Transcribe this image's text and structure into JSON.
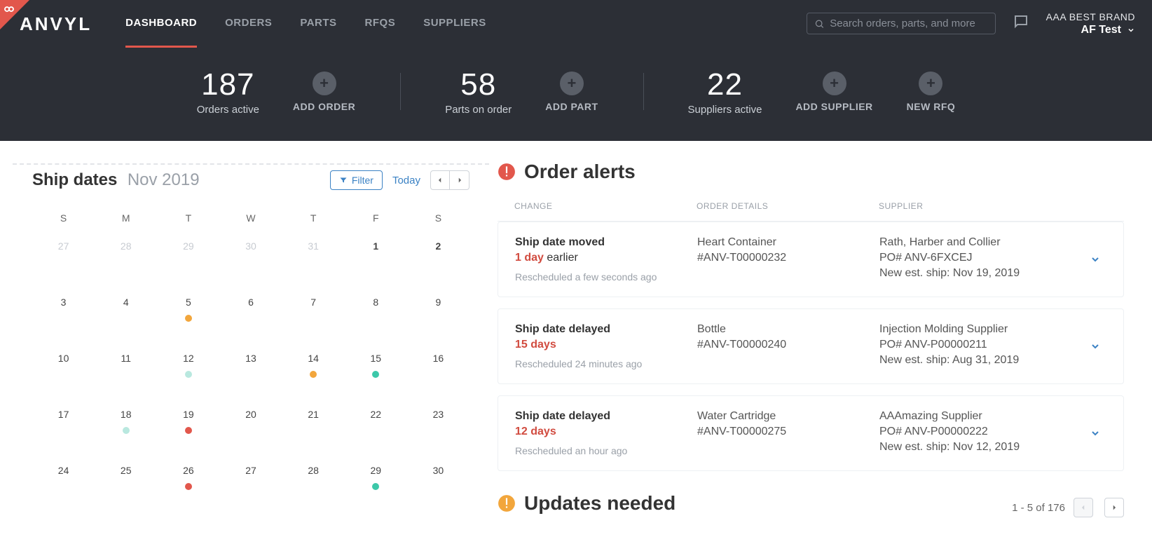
{
  "header": {
    "logo": "ANVYL",
    "nav": [
      "DASHBOARD",
      "ORDERS",
      "PARTS",
      "RFQS",
      "SUPPLIERS"
    ],
    "nav_active_index": 0,
    "search_placeholder": "Search orders, parts, and more",
    "brand_name": "AAA BEST BRAND",
    "brand_user": "AF Test"
  },
  "stats": [
    {
      "value": "187",
      "label": "Orders active",
      "actions": [
        {
          "label": "ADD ORDER"
        }
      ]
    },
    {
      "value": "58",
      "label": "Parts on order",
      "actions": [
        {
          "label": "ADD PART"
        }
      ]
    },
    {
      "value": "22",
      "label": "Suppliers active",
      "actions": [
        {
          "label": "ADD SUPPLIER"
        },
        {
          "label": "NEW RFQ"
        }
      ]
    }
  ],
  "calendar": {
    "title": "Ship dates",
    "month": "Nov 2019",
    "filter_label": "Filter",
    "today_label": "Today",
    "dow": [
      "S",
      "M",
      "T",
      "W",
      "T",
      "F",
      "S"
    ],
    "cells": [
      {
        "n": "27",
        "dim": true
      },
      {
        "n": "28",
        "dim": true
      },
      {
        "n": "29",
        "dim": true
      },
      {
        "n": "30",
        "dim": true
      },
      {
        "n": "31",
        "dim": true
      },
      {
        "n": "1",
        "bold": true
      },
      {
        "n": "2",
        "bold": true
      },
      {
        "n": "3"
      },
      {
        "n": "4"
      },
      {
        "n": "5",
        "dot": "orange"
      },
      {
        "n": "6"
      },
      {
        "n": "7"
      },
      {
        "n": "8"
      },
      {
        "n": "9"
      },
      {
        "n": "10"
      },
      {
        "n": "11"
      },
      {
        "n": "12",
        "dot": "mint"
      },
      {
        "n": "13"
      },
      {
        "n": "14",
        "dot": "orange"
      },
      {
        "n": "15",
        "dot": "teal"
      },
      {
        "n": "16"
      },
      {
        "n": "17"
      },
      {
        "n": "18",
        "dot": "mint"
      },
      {
        "n": "19",
        "dot": "red"
      },
      {
        "n": "20"
      },
      {
        "n": "21"
      },
      {
        "n": "22"
      },
      {
        "n": "23"
      },
      {
        "n": "24"
      },
      {
        "n": "25"
      },
      {
        "n": "26",
        "dot": "red"
      },
      {
        "n": "27"
      },
      {
        "n": "28"
      },
      {
        "n": "29",
        "dot": "teal"
      },
      {
        "n": "30"
      }
    ]
  },
  "alerts": {
    "title": "Order alerts",
    "columns": {
      "change": "CHANGE",
      "details": "ORDER DETAILS",
      "supplier": "SUPPLIER"
    },
    "rows": [
      {
        "change_title": "Ship date moved",
        "change_delta": "1 day",
        "change_suffix": " earlier",
        "change_meta": "Rescheduled a few seconds ago",
        "detail_name": "Heart Container",
        "detail_sku": "#ANV-T00000232",
        "supplier_name": "Rath, Harber and Collier",
        "supplier_po": "PO# ANV-6FXCEJ",
        "new_ship": "New est. ship: Nov 19, 2019"
      },
      {
        "change_title": "Ship date delayed",
        "change_delta": "15 days",
        "change_suffix": "",
        "change_meta": "Rescheduled 24 minutes ago",
        "detail_name": "Bottle",
        "detail_sku": "#ANV-T00000240",
        "supplier_name": "Injection Molding Supplier",
        "supplier_po": "PO# ANV-P00000211",
        "new_ship": "New est. ship: Aug 31, 2019"
      },
      {
        "change_title": "Ship date delayed",
        "change_delta": "12 days",
        "change_suffix": "",
        "change_meta": "Rescheduled an hour ago",
        "detail_name": "Water Cartridge",
        "detail_sku": "#ANV-T00000275",
        "supplier_name": "AAAmazing Supplier",
        "supplier_po": "PO# ANV-P00000222",
        "new_ship": "New est. ship: Nov 12, 2019"
      }
    ]
  },
  "updates": {
    "title": "Updates needed",
    "pager": "1 - 5 of 176"
  }
}
